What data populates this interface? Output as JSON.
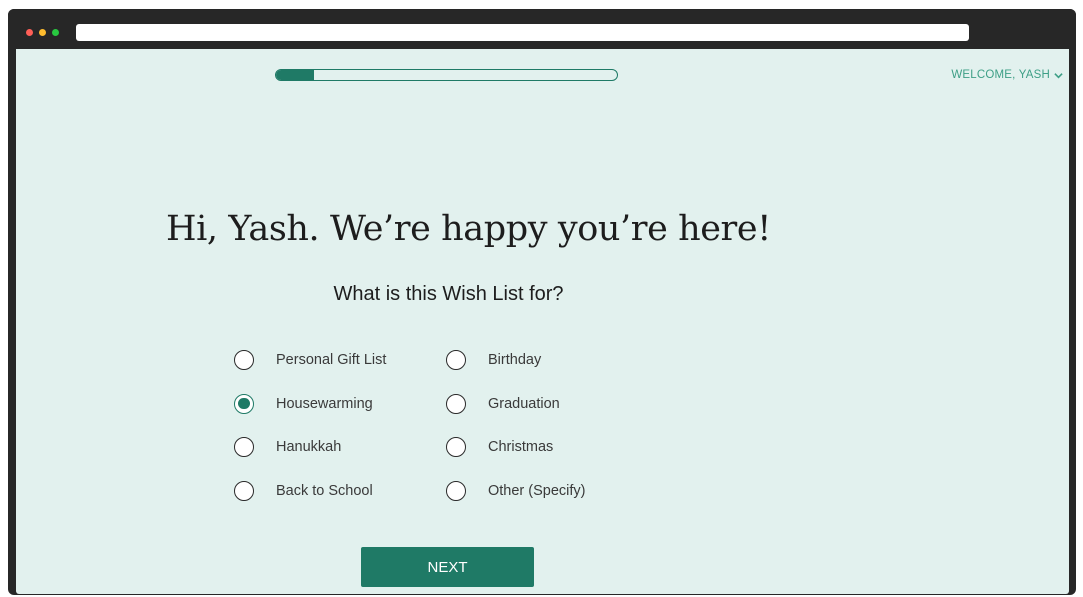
{
  "header": {
    "welcome_label": "WELCOME, YASH",
    "welcome_icon": "chevron-down-icon"
  },
  "progress": {
    "fraction": 0.11
  },
  "main": {
    "greeting": "Hi, Yash. We’re happy you’re here!",
    "question": "What is this Wish List for?",
    "options": [
      {
        "label": "Personal Gift List",
        "selected": false
      },
      {
        "label": "Birthday",
        "selected": false
      },
      {
        "label": "Housewarming",
        "selected": true
      },
      {
        "label": "Graduation",
        "selected": false
      },
      {
        "label": "Hanukkah",
        "selected": false
      },
      {
        "label": "Christmas",
        "selected": false
      },
      {
        "label": "Back to School",
        "selected": false
      },
      {
        "label": "Other (Specify)",
        "selected": false
      }
    ],
    "next_label": "NEXT"
  },
  "colors": {
    "accent": "#1f7a66",
    "accent_light": "#3e9f86",
    "background": "#e2f1ee",
    "chrome": "#272727"
  }
}
